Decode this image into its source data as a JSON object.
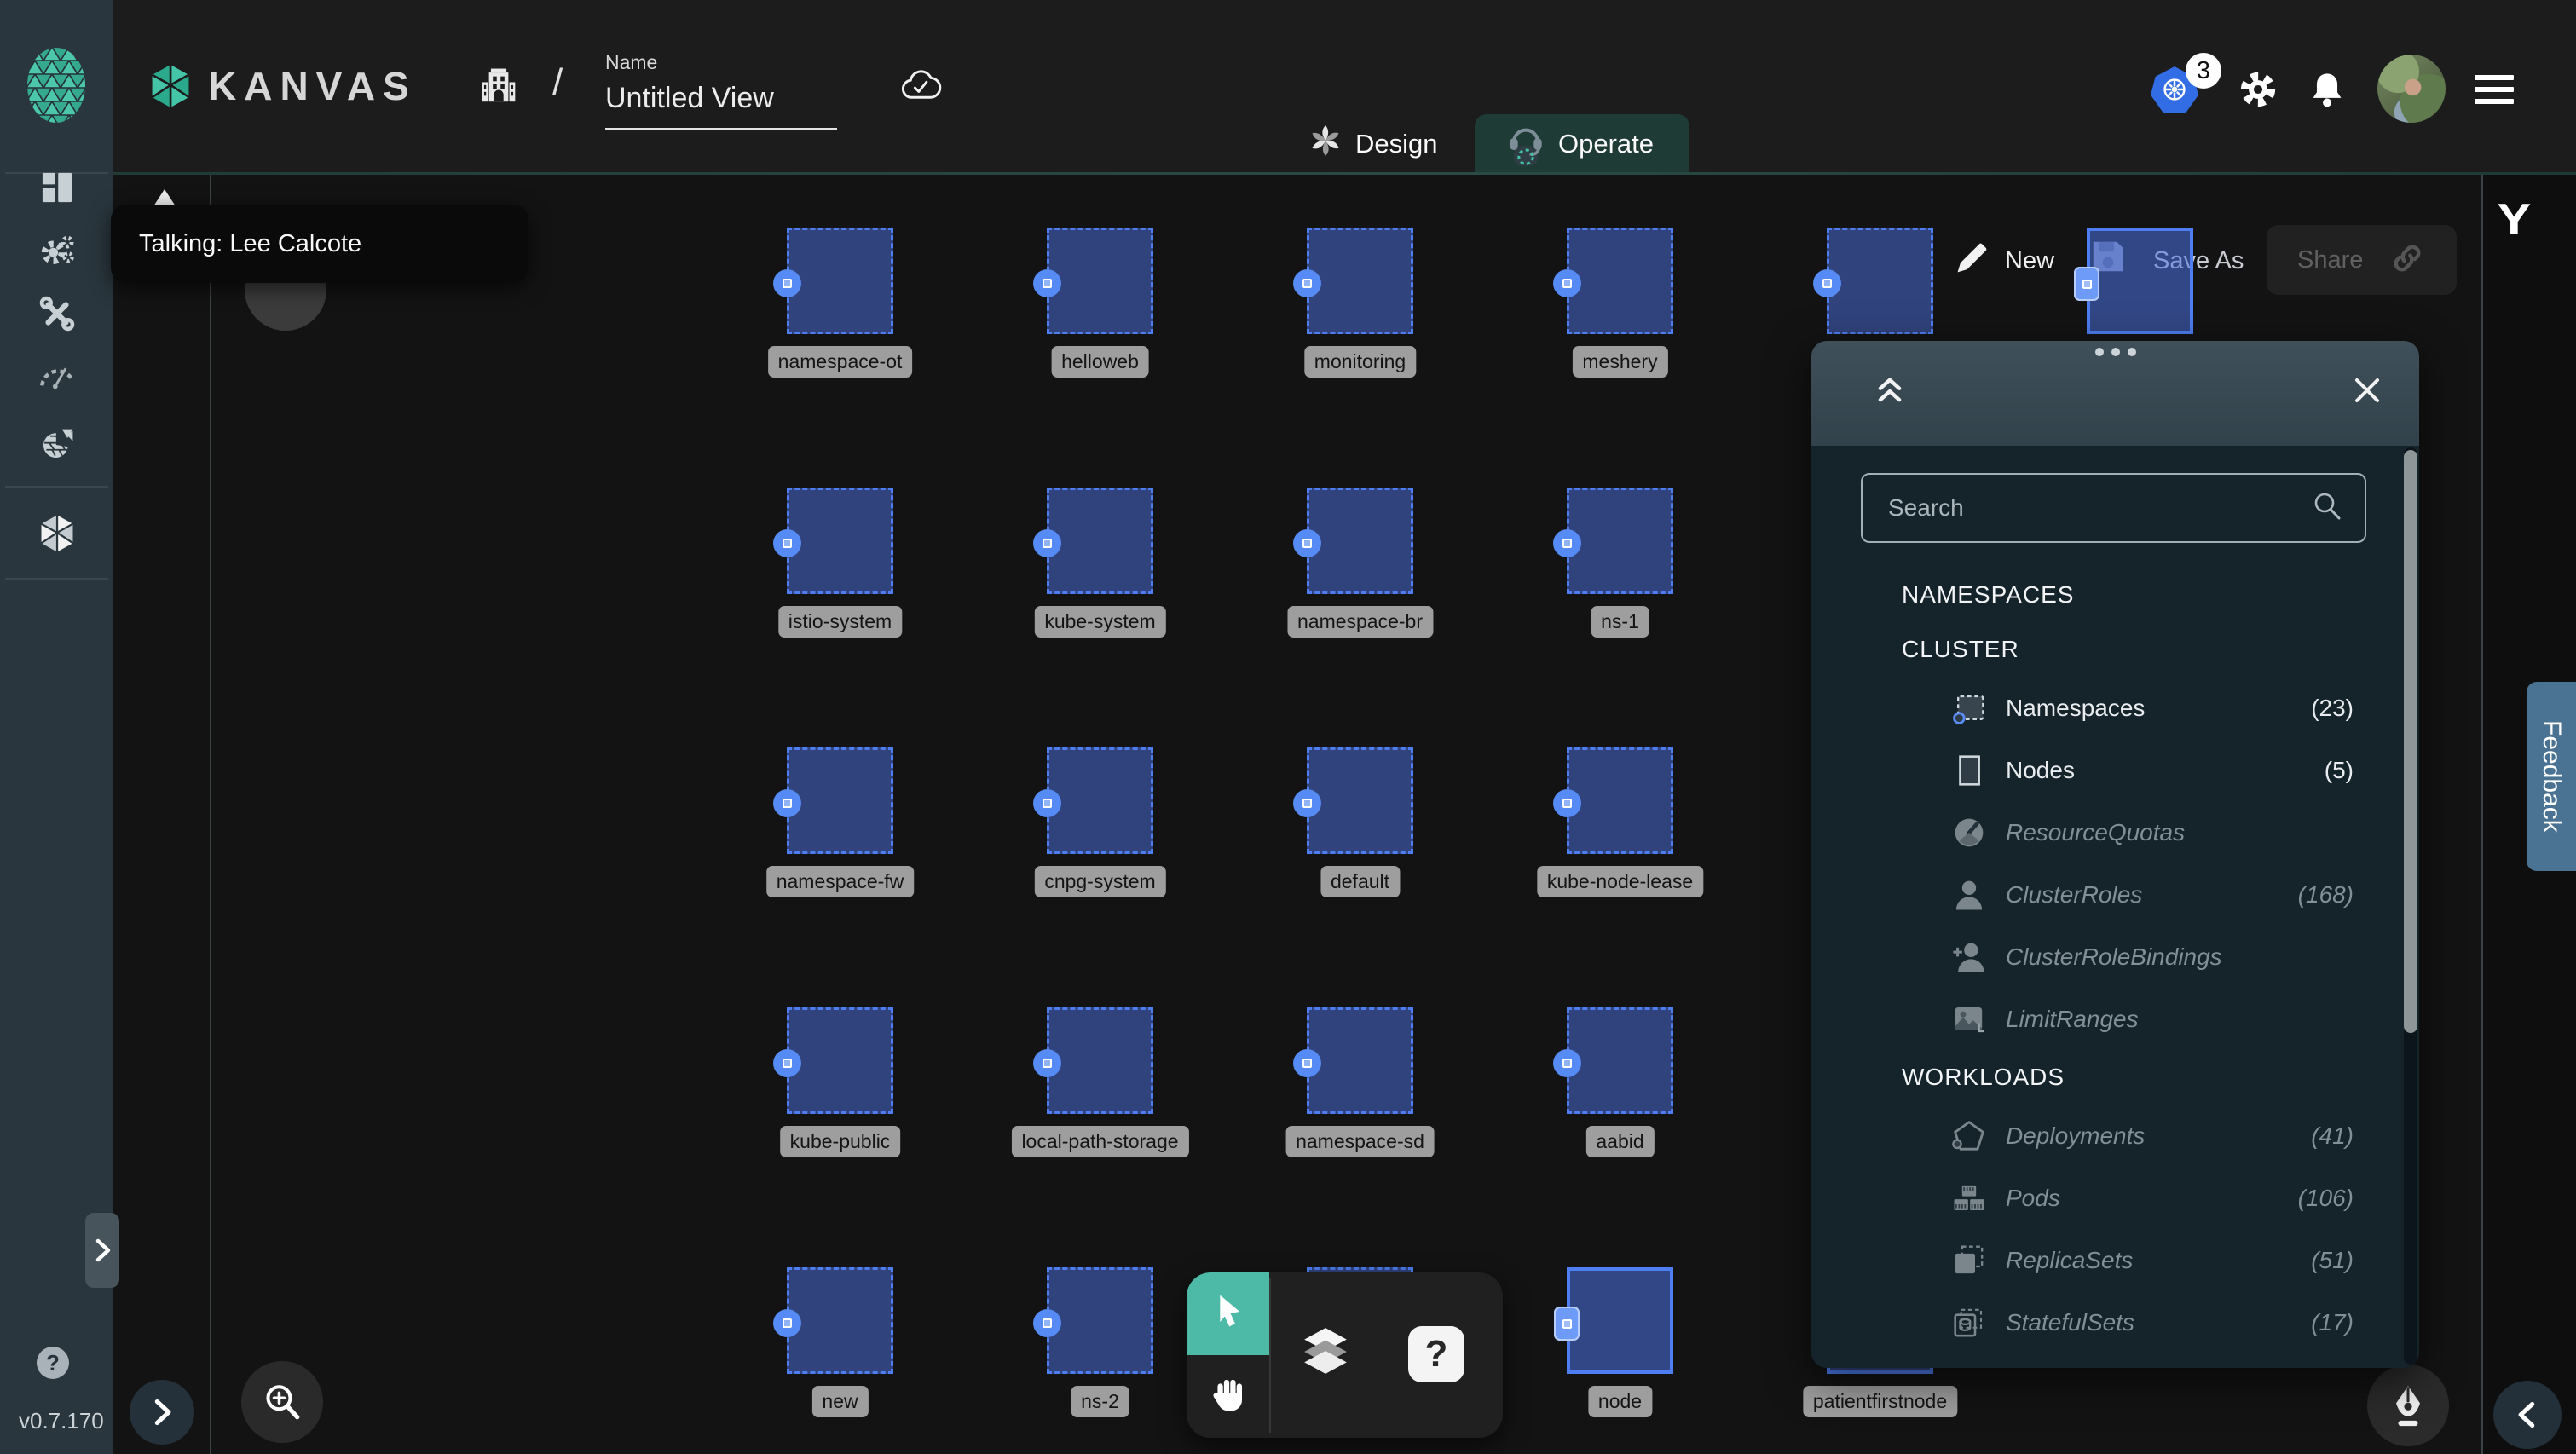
{
  "topbar": {
    "brand": "KANVAS",
    "separator": "/",
    "name_label": "Name",
    "doc_name": "Untitled View",
    "badge_count": "3"
  },
  "tabs": {
    "design": "Design",
    "operate": "Operate"
  },
  "toolbar": {
    "new": "New",
    "save_as": "Save As",
    "share": "Share"
  },
  "tooltip": "Talking: Lee Calcote",
  "collab_cursor_glyph": "Y",
  "sidebar": {
    "version": "v0.7.170",
    "help_glyph": "?",
    "items": [
      {
        "name": "dashboard"
      },
      {
        "name": "lifecycle"
      },
      {
        "name": "toolbox"
      },
      {
        "name": "performance"
      },
      {
        "name": "extensions"
      },
      {
        "name": "kanvas",
        "active": true
      }
    ]
  },
  "canvas": {
    "grid": {
      "cols": [
        923,
        1228,
        1533,
        1838,
        2143,
        2448
      ],
      "rows": [
        267,
        572,
        877,
        1182,
        1487
      ],
      "size": 125
    },
    "nodes": [
      {
        "row": 0,
        "col": 0,
        "label": "namespace-ot"
      },
      {
        "row": 0,
        "col": 1,
        "label": "helloweb"
      },
      {
        "row": 0,
        "col": 2,
        "label": "monitoring"
      },
      {
        "row": 0,
        "col": 3,
        "label": "meshery"
      },
      {
        "row": 0,
        "col": 4
      },
      {
        "row": 0,
        "col": 5,
        "selected": true
      },
      {
        "row": 1,
        "col": 0,
        "label": "istio-system"
      },
      {
        "row": 1,
        "col": 1,
        "label": "kube-system"
      },
      {
        "row": 1,
        "col": 2,
        "label": "namespace-br"
      },
      {
        "row": 1,
        "col": 3,
        "label": "ns-1"
      },
      {
        "row": 2,
        "col": 0,
        "label": "namespace-fw"
      },
      {
        "row": 2,
        "col": 1,
        "label": "cnpg-system"
      },
      {
        "row": 2,
        "col": 2,
        "label": "default"
      },
      {
        "row": 2,
        "col": 3,
        "label": "kube-node-lease"
      },
      {
        "row": 3,
        "col": 0,
        "label": "kube-public"
      },
      {
        "row": 3,
        "col": 1,
        "label": "local-path-storage"
      },
      {
        "row": 3,
        "col": 2,
        "label": "namespace-sd"
      },
      {
        "row": 3,
        "col": 3,
        "label": "aabid"
      },
      {
        "row": 4,
        "col": 0,
        "label": "new"
      },
      {
        "row": 4,
        "col": 1,
        "label": "ns-2"
      },
      {
        "row": 4,
        "col": 2
      },
      {
        "row": 4,
        "col": 3,
        "label": "node",
        "selected": true
      },
      {
        "row": 4,
        "col": 4,
        "label": "patientfirstnode",
        "selected": true
      }
    ]
  },
  "dock": {
    "help_glyph": "?"
  },
  "panel": {
    "search_placeholder": "Search",
    "groups": [
      {
        "heading": "NAMESPACES",
        "items": []
      },
      {
        "heading": "CLUSTER",
        "items": [
          {
            "icon": "namespace",
            "label": "Namespaces",
            "count": "(23)",
            "enabled": true
          },
          {
            "icon": "nodeicon",
            "label": "Nodes",
            "count": "(5)",
            "enabled": true
          },
          {
            "icon": "quota",
            "label": "ResourceQuotas",
            "count": "",
            "enabled": false
          },
          {
            "icon": "person",
            "label": "ClusterRoles",
            "count": "(168)",
            "enabled": false
          },
          {
            "icon": "personplus",
            "label": "ClusterRoleBindings",
            "count": "",
            "enabled": false
          },
          {
            "icon": "limitrange",
            "label": "LimitRanges",
            "count": "",
            "enabled": false
          }
        ]
      },
      {
        "heading": "WORKLOADS",
        "items": [
          {
            "icon": "pentagon",
            "label": "Deployments",
            "count": "(41)",
            "enabled": false
          },
          {
            "icon": "pods",
            "label": "Pods",
            "count": "(106)",
            "enabled": false
          },
          {
            "icon": "replicaset",
            "label": "ReplicaSets",
            "count": "(51)",
            "enabled": false
          },
          {
            "icon": "statefulset",
            "label": "StatefulSets",
            "count": "(17)",
            "enabled": false
          }
        ]
      }
    ]
  },
  "feedback_label": "Feedback",
  "colors": {
    "accent_teal": "#4cbaa6",
    "node_blue": "#4e7ef2",
    "k8s_blue": "#326de6",
    "panel_bg": "#15232b"
  }
}
